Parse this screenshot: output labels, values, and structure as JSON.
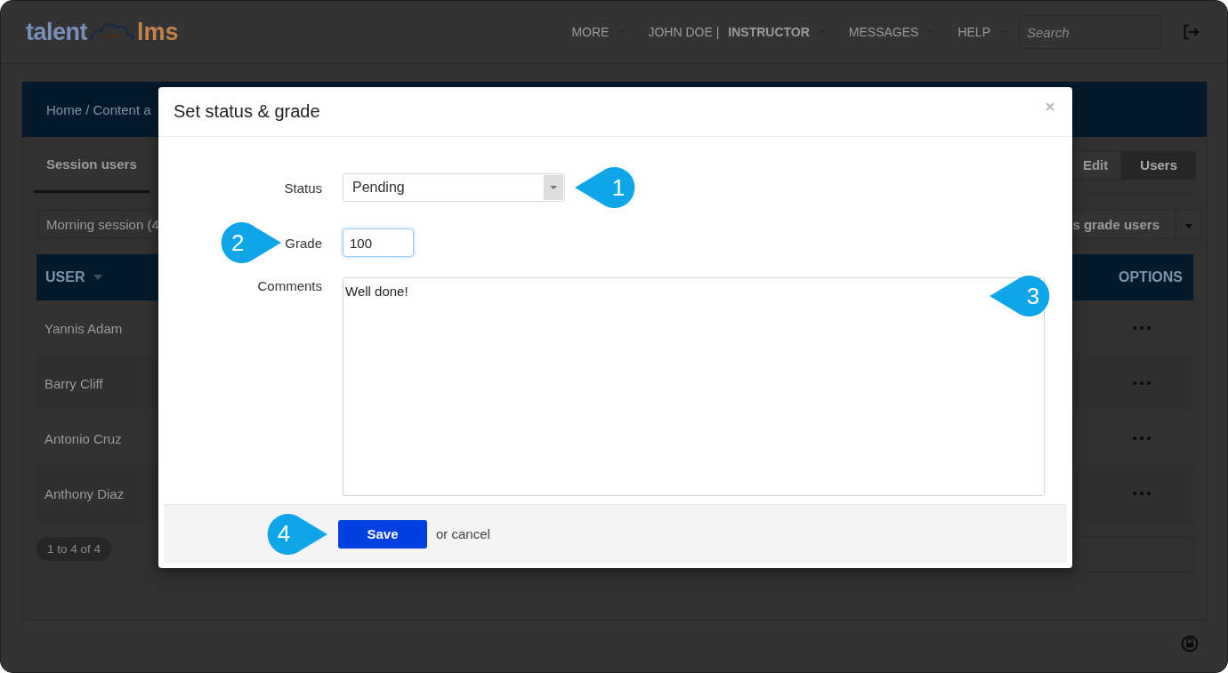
{
  "header": {
    "logo": {
      "left": "talent",
      "right": "lms"
    },
    "nav": [
      {
        "label": "MORE",
        "caret": true
      },
      {
        "label": "JOHN DOE | **INSTRUCTOR**",
        "caret": true
      },
      {
        "label": "MESSAGES",
        "caret": true
      },
      {
        "label": "HELP",
        "caret": true
      }
    ],
    "search": {
      "placeholder": "Search"
    }
  },
  "panel": {
    "breadcrumb": "Home / Content a",
    "tabs": [
      {
        "label": "Session users",
        "selected": true
      }
    ],
    "view_buttons": [
      {
        "label": "Edit",
        "selected": false
      },
      {
        "label": "Users",
        "selected": true
      }
    ],
    "session_select": "Morning session (4",
    "mass_action": "s grade users",
    "table": {
      "columns": [
        "USER",
        "OPTIONS"
      ],
      "rows": [
        {
          "user": "Yannis Adam"
        },
        {
          "user": "Barry Cliff"
        },
        {
          "user": "Antonio Cruz"
        },
        {
          "user": "Anthony Diaz"
        }
      ]
    },
    "pagination": "1 to 4 of 4"
  },
  "dialog": {
    "title": "Set status & grade",
    "fields": [
      {
        "kind": "select",
        "label": "Status",
        "value": "Pending"
      },
      {
        "kind": "text",
        "label": "Grade",
        "value": "100",
        "focused": true
      },
      {
        "kind": "textarea",
        "label": "Comments",
        "value": "Well done!"
      }
    ],
    "callouts": [
      "1",
      "2",
      "3",
      "4"
    ],
    "save": "Save",
    "cancel": "or cancel"
  }
}
